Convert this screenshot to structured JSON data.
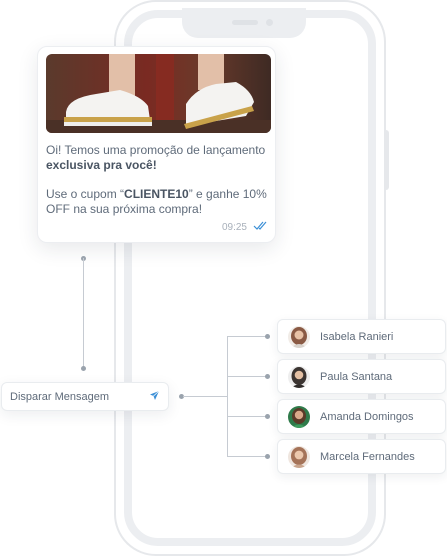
{
  "message": {
    "line1_prefix": "Oi! Temos uma promoção de lançamento ",
    "line1_bold": "exclusiva pra você!",
    "line2_prefix": "Use o cupom “",
    "coupon": "CLIENTE10",
    "line2_suffix": "” e ganhe 10% OFF na sua próxima compra!",
    "time": "09:25"
  },
  "dispatch": {
    "label": "Disparar Mensagem",
    "icon": "send-icon"
  },
  "contacts": [
    {
      "name": "Isabela Ranieri",
      "avatar_bg": "#8a5a44"
    },
    {
      "name": "Paula Santana",
      "avatar_bg": "#3b3431"
    },
    {
      "name": "Amanda Domingos",
      "avatar_bg": "#2f7a4a"
    },
    {
      "name": "Marcela Fernandes",
      "avatar_bg": "#a57358"
    }
  ],
  "colors": {
    "accent": "#3b8fd6",
    "line": "#c6cbd2",
    "dot": "#9aa3ad"
  }
}
